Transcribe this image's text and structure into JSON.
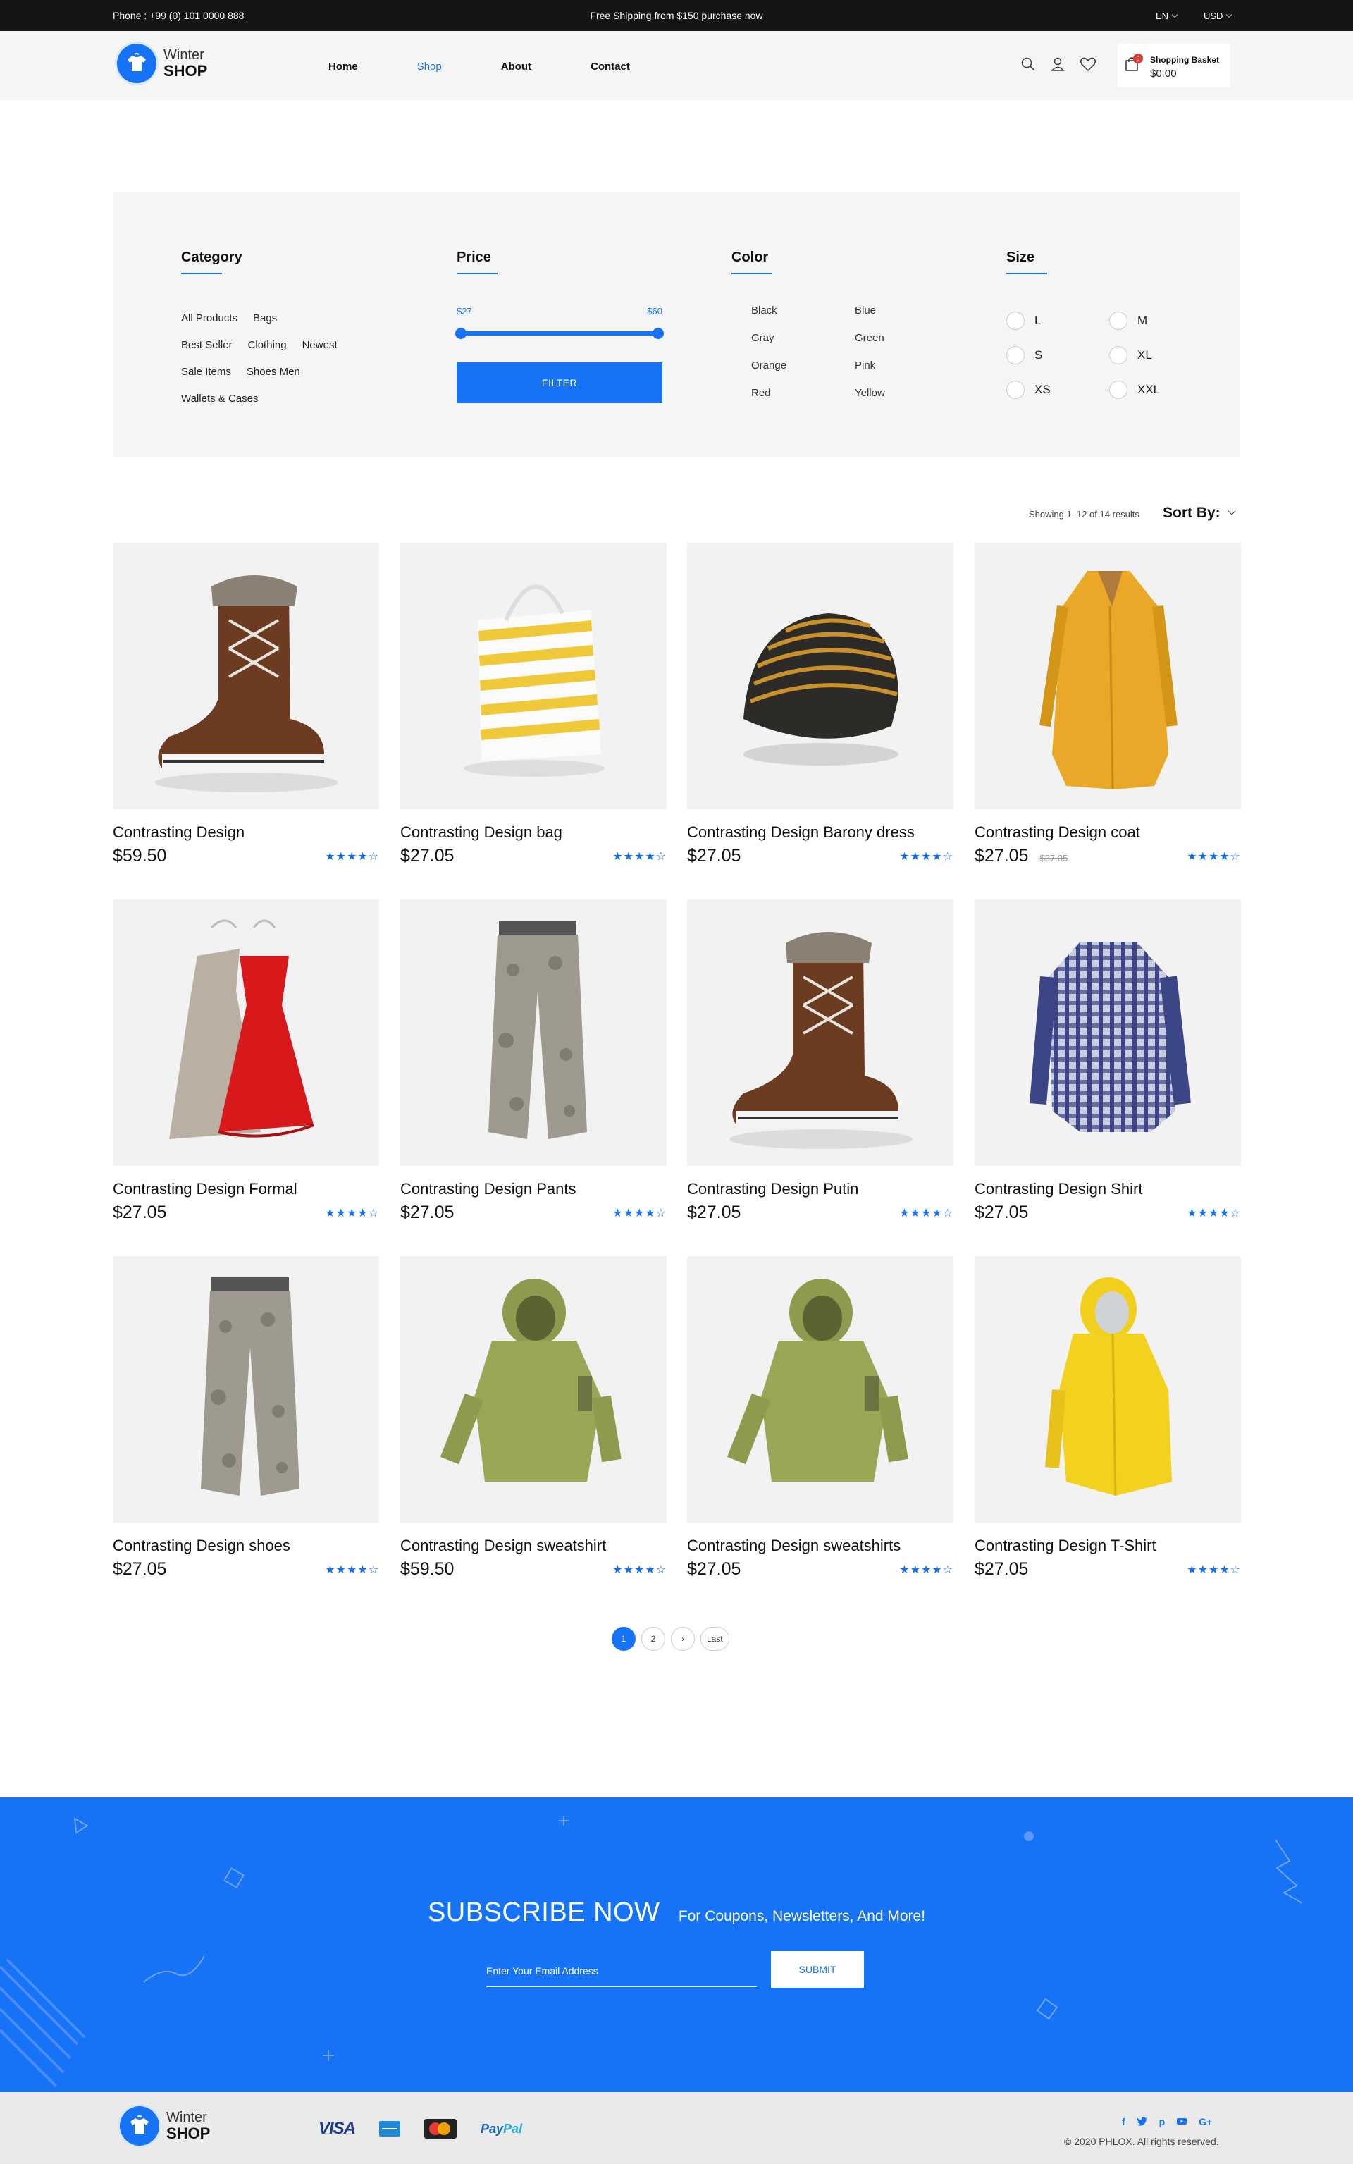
{
  "topbar": {
    "phone": "Phone : +99 (0) 101 0000 888",
    "promo": "Free Shipping from $150 purchase now",
    "language": "EN",
    "currency": "USD"
  },
  "brand": {
    "line1": "Winter",
    "line2": "SHOP"
  },
  "nav": {
    "items": [
      {
        "label": "Home",
        "active": false
      },
      {
        "label": "Shop",
        "active": true
      },
      {
        "label": "About",
        "active": false
      },
      {
        "label": "Contact",
        "active": false
      }
    ]
  },
  "header_icons": [
    "search-icon",
    "user-icon",
    "heart-icon"
  ],
  "basket": {
    "label": "Shopping Basket",
    "amount": "$0.00",
    "count": "0"
  },
  "filter": {
    "category": {
      "title": "Category",
      "items": [
        "All Products",
        "Bags",
        "Best Seller",
        "Clothing",
        "Newest",
        "Sale Items",
        "Shoes Men",
        "Wallets & Cases"
      ]
    },
    "price": {
      "title": "Price",
      "min": "$27",
      "max": "$60",
      "button": "FILTER"
    },
    "color": {
      "title": "Color",
      "items": [
        "Black",
        "Blue",
        "Gray",
        "Green",
        "Orange",
        "Pink",
        "Red",
        "Yellow"
      ]
    },
    "size": {
      "title": "Size",
      "items": [
        "L",
        "M",
        "S",
        "XL",
        "XS",
        "XXL"
      ]
    }
  },
  "results": {
    "text": "Showing 1–12 of 14 results",
    "sort_label": "Sort By:"
  },
  "products": [
    {
      "name": "Contrasting Design",
      "price": "$59.50",
      "old_price": "",
      "rating": 4,
      "image": "boot"
    },
    {
      "name": "Contrasting Design bag",
      "price": "$27.05",
      "old_price": "",
      "rating": 4,
      "image": "bag"
    },
    {
      "name": "Contrasting Design Barony dress",
      "price": "$27.05",
      "old_price": "",
      "rating": 4,
      "image": "beanie"
    },
    {
      "name": "Contrasting Design coat",
      "price": "$27.05",
      "old_price": "$37.05",
      "rating": 4,
      "image": "coat"
    },
    {
      "name": "Contrasting Design Formal",
      "price": "$27.05",
      "old_price": "",
      "rating": 4,
      "image": "dress"
    },
    {
      "name": "Contrasting Design Pants",
      "price": "$27.05",
      "old_price": "",
      "rating": 4,
      "image": "pants"
    },
    {
      "name": "Contrasting Design Putin",
      "price": "$27.05",
      "old_price": "",
      "rating": 4,
      "image": "boot"
    },
    {
      "name": "Contrasting Design Shirt",
      "price": "$27.05",
      "old_price": "",
      "rating": 4,
      "image": "shirt"
    },
    {
      "name": "Contrasting Design shoes",
      "price": "$27.05",
      "old_price": "",
      "rating": 4,
      "image": "pants"
    },
    {
      "name": "Contrasting Design sweatshirt",
      "price": "$59.50",
      "old_price": "",
      "rating": 4,
      "image": "jacket"
    },
    {
      "name": "Contrasting Design sweatshirts",
      "price": "$27.05",
      "old_price": "",
      "rating": 4,
      "image": "jacket"
    },
    {
      "name": "Contrasting Design T-Shirt",
      "price": "$27.05",
      "old_price": "",
      "rating": 4,
      "image": "raincoat"
    }
  ],
  "pagination": {
    "pages": [
      "1",
      "2"
    ],
    "next": "›",
    "last": "Last",
    "current": "1"
  },
  "subscribe": {
    "title": "SUBSCRIBE NOW",
    "subtitle": "For Coupons, Newsletters, And More!",
    "placeholder": "Enter Your Email Address",
    "button": "SUBMIT"
  },
  "footer": {
    "payments": {
      "visa": "VISA",
      "paypal_a": "Pay",
      "paypal_b": "Pal"
    },
    "social": [
      "f",
      "t",
      "p",
      "yt",
      "G+"
    ],
    "copyright": "© 2020 PHLOX. All rights reserved."
  },
  "colors": {
    "accent": "#1673f5",
    "topbar": "#151515",
    "panel": "#f5f5f5"
  }
}
